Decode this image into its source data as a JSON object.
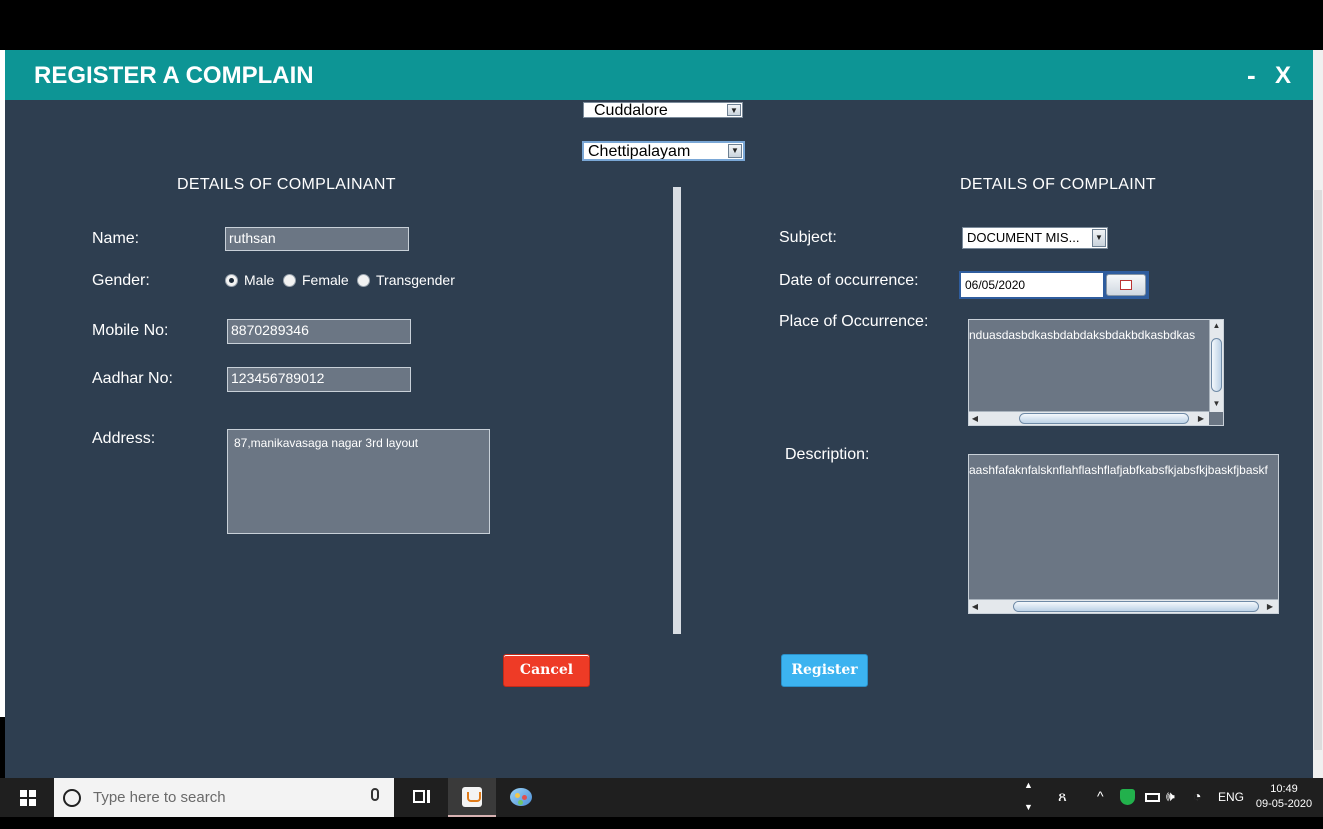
{
  "window": {
    "title": "REGISTER A COMPLAIN",
    "minimize": "-",
    "close": "X"
  },
  "location": {
    "district": "Cuddalore",
    "area": "Chettipalayam"
  },
  "complainant": {
    "heading": "DETAILS  OF  COMPLAINANT",
    "name_label": "Name:",
    "name_value": "ruthsan",
    "gender_label": "Gender:",
    "gender_options": [
      "Male",
      "Female",
      "Transgender"
    ],
    "gender_selected": "Male",
    "mobile_label": "Mobile No:",
    "mobile_value": "8870289346",
    "aadhar_label": "Aadhar No:",
    "aadhar_value": "123456789012",
    "address_label": "Address:",
    "address_value": "87,manikavasaga nagar 3rd layout"
  },
  "complaint": {
    "heading": "DETAILS OF COMPLAINT",
    "subject_label": "Subject:",
    "subject_value": "DOCUMENT MIS...",
    "date_label": "Date of occurrence:",
    "date_value": "06/05/2020",
    "place_label": "Place of Occurrence:",
    "place_value": "nduasdasbdkasbdabdaksbdakbdkasbdkas",
    "description_label": "Description:",
    "description_value": "aashfafaknfalsknflahflashflafjabfkabsfkjabsfkjbaskfjbaskf"
  },
  "actions": {
    "cancel": "Cancel",
    "register": "Register"
  },
  "colors": {
    "titlebar": "#0d9595",
    "background": "#2e3e50",
    "field": "#6b7684",
    "cancel": "#ee3b26",
    "register": "#3cb3f0"
  },
  "taskbar": {
    "search_placeholder": "Type here to search",
    "lang": "ENG",
    "time": "10:49",
    "date": "09-05-2020"
  }
}
